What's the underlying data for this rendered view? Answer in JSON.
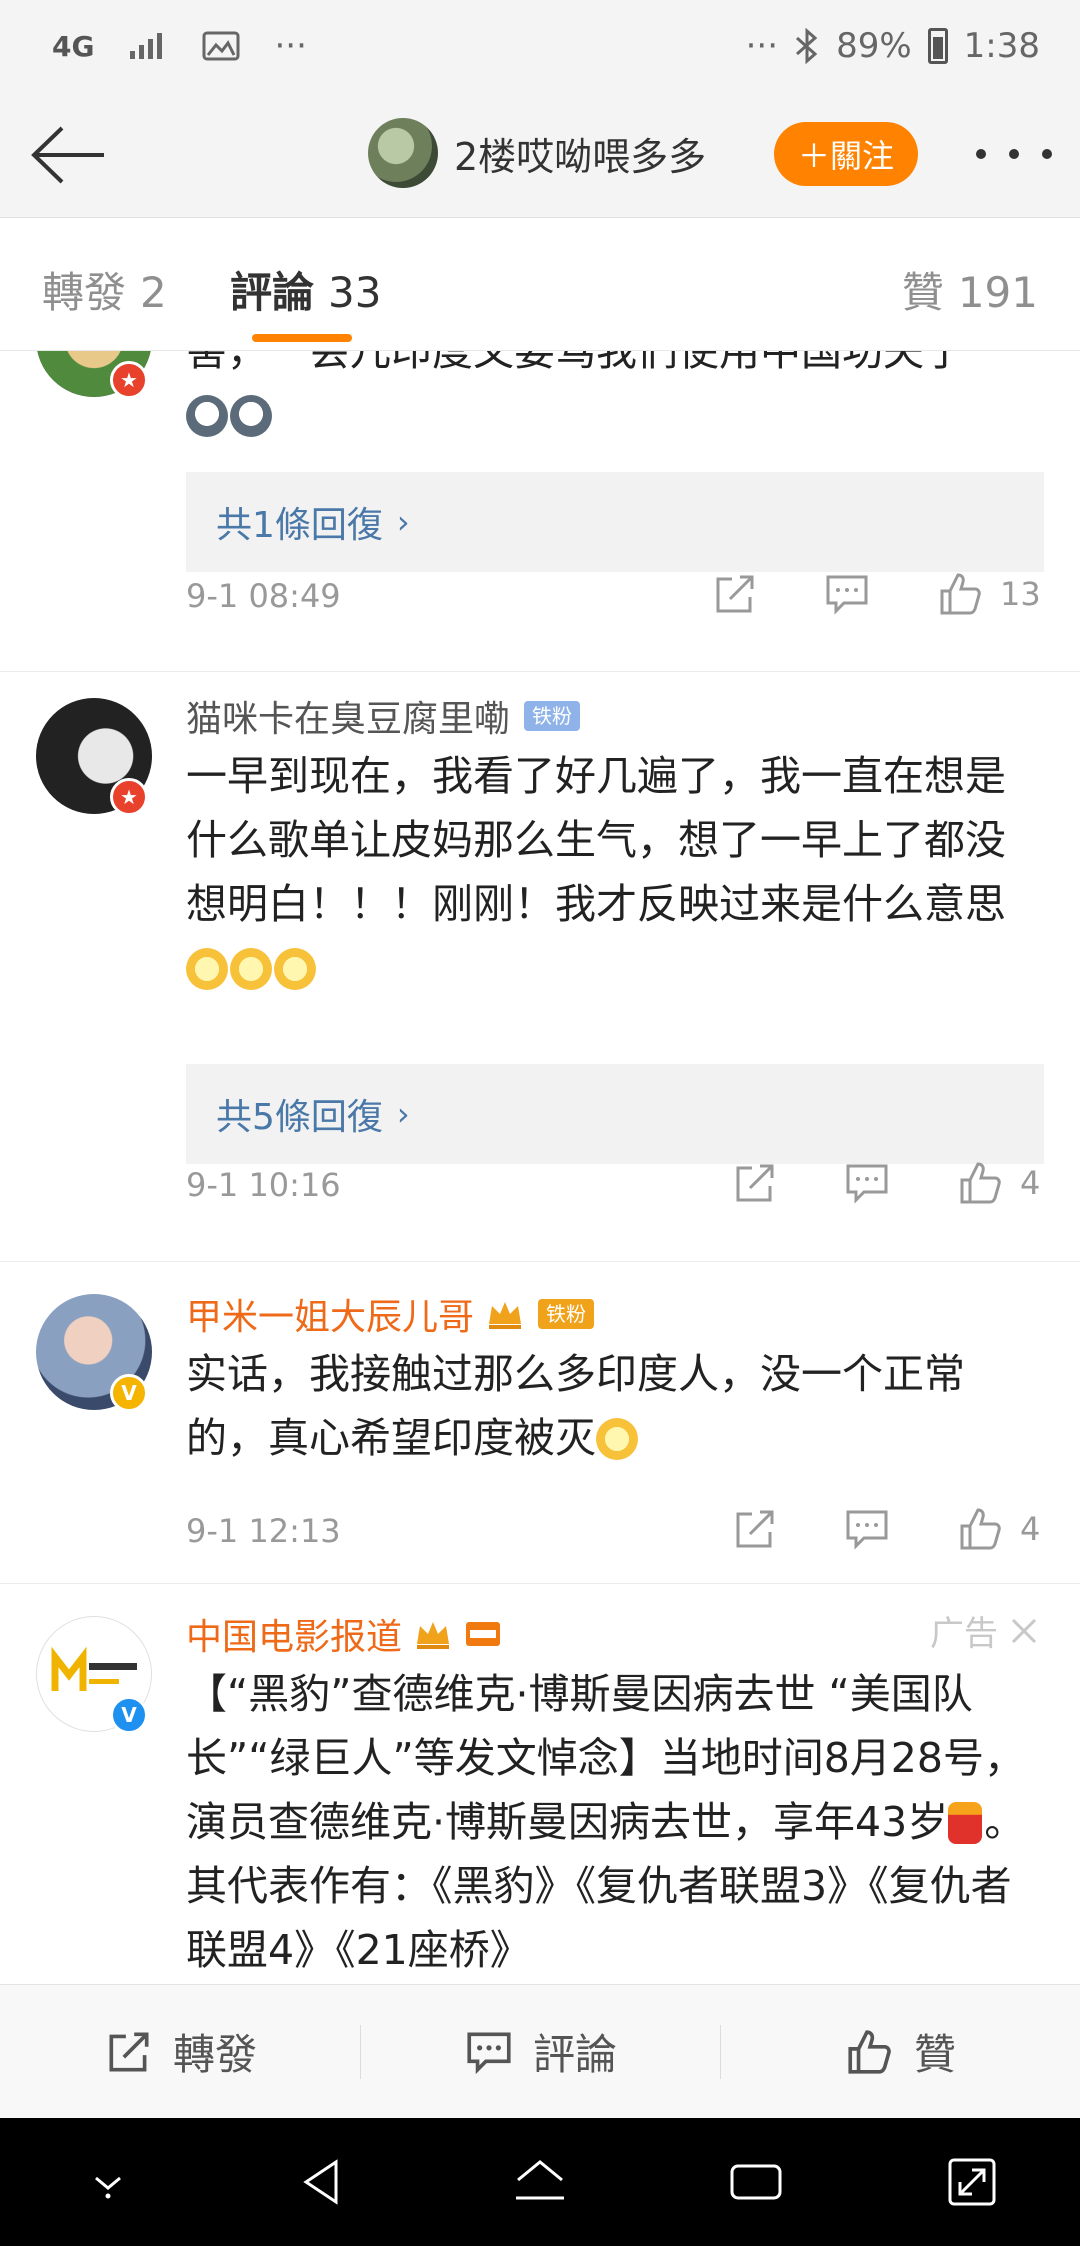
{
  "status_bar": {
    "network": "4G",
    "more": "···",
    "dots_right": "···",
    "battery": "89%",
    "time": "1:38"
  },
  "header": {
    "username": "2楼哎呦喂多多",
    "follow_label": "＋關注"
  },
  "tabs": {
    "repost": {
      "label": "轉發",
      "count": "2"
    },
    "comments": {
      "label": "評論",
      "count": "33"
    },
    "likes": {
      "label": "贊",
      "count": "191"
    }
  },
  "comments": [
    {
      "text": "害，一会儿印度又要骂我们使用中国功夫了",
      "replies": "共1條回復",
      "time": "9-1 08:49",
      "likes": "13",
      "emojis": [
        "dog-emoji",
        "dog-emoji"
      ]
    },
    {
      "name": "猫咪卡在臭豆腐里嘞",
      "tag": "铁粉",
      "text": "一早到现在，我看了好几遍了，我一直在想是什么歌单让皮妈那么生气，想了一早上了都没想明白！！！刚刚！我才反映过来是什么意思",
      "replies": "共5條回復",
      "time": "9-1 10:16",
      "likes": "4"
    },
    {
      "name": "甲米一姐大辰儿哥",
      "tag": "铁粉",
      "text": "实话，我接触过那么多印度人，没一个正常的，真心希望印度被灭",
      "time": "9-1 12:13",
      "likes": "4"
    },
    {
      "name": "中国电影报道",
      "ad_label": "广告",
      "text": "【“黑豹”查德维克·博斯曼因病去世 “美国队长”“绿巨人”等发文悼念】当地时间8月28号，演员查德维克·博斯曼因病去世，享年43岁",
      "text_tail": "。其代表作有：《黑豹》《复仇者联盟3》《复仇者联盟4》《21座桥》"
    }
  ],
  "bottom_bar": {
    "repost": "轉發",
    "comment": "評論",
    "like": "贊"
  },
  "colors": {
    "accent": "#ff8200",
    "link": "#4a78a8",
    "vip_name": "#ee6a18"
  }
}
